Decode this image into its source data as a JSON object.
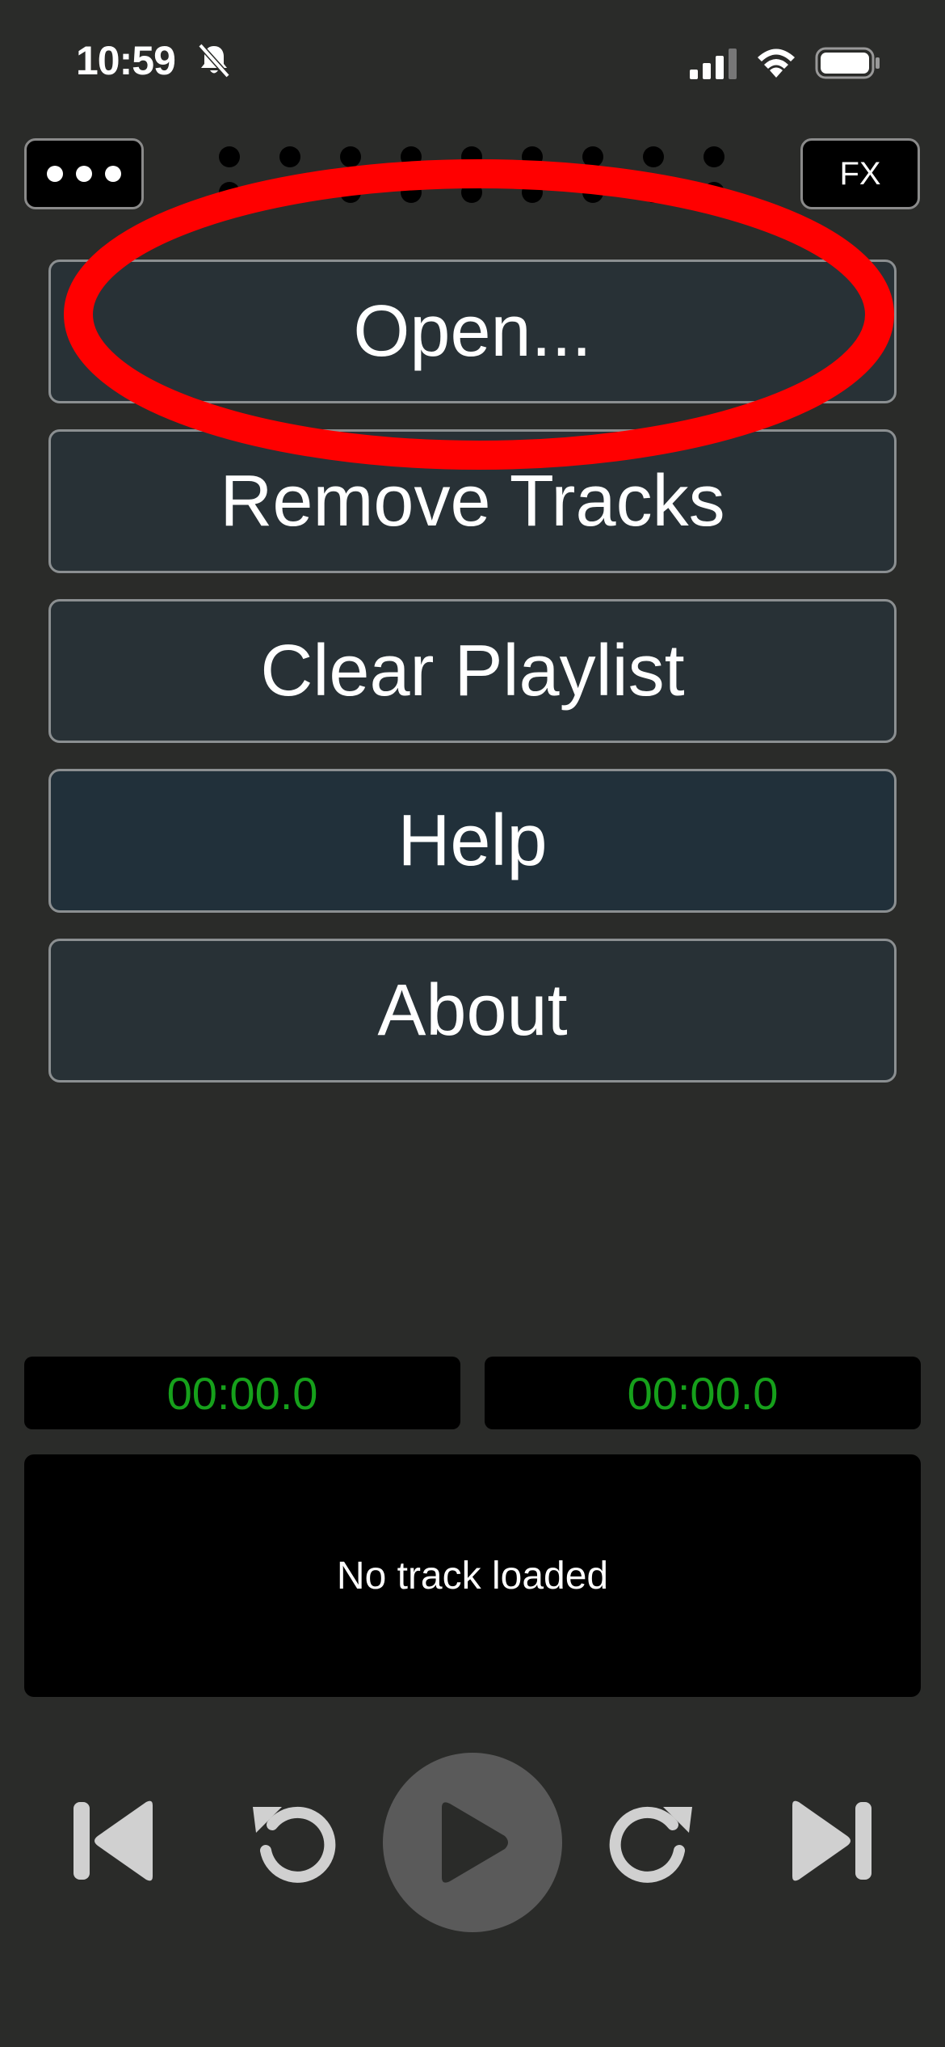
{
  "status_bar": {
    "time": "10:59",
    "icons": [
      "bell-slash-icon",
      "cellular-signal-icon",
      "wifi-icon",
      "battery-icon"
    ]
  },
  "toolbar": {
    "menu_icon": "ellipsis-icon",
    "fx_label": "FX",
    "grip_icon": "drag-grip-icon"
  },
  "menu": {
    "items": [
      {
        "label": "Open..."
      },
      {
        "label": "Remove Tracks"
      },
      {
        "label": "Clear Playlist"
      },
      {
        "label": "Help"
      },
      {
        "label": "About"
      }
    ]
  },
  "timers": {
    "elapsed": "00:00.0",
    "remaining": "00:00.0"
  },
  "track": {
    "status": "No track loaded"
  },
  "transport": {
    "icons": [
      "skip-previous-icon",
      "rewind-icon",
      "play-icon",
      "fast-forward-icon",
      "skip-next-icon"
    ]
  },
  "colors": {
    "background": "#2a2b29",
    "button_fill": "#283136",
    "timer_text": "#16a01b",
    "annotation": "#ff0000"
  }
}
